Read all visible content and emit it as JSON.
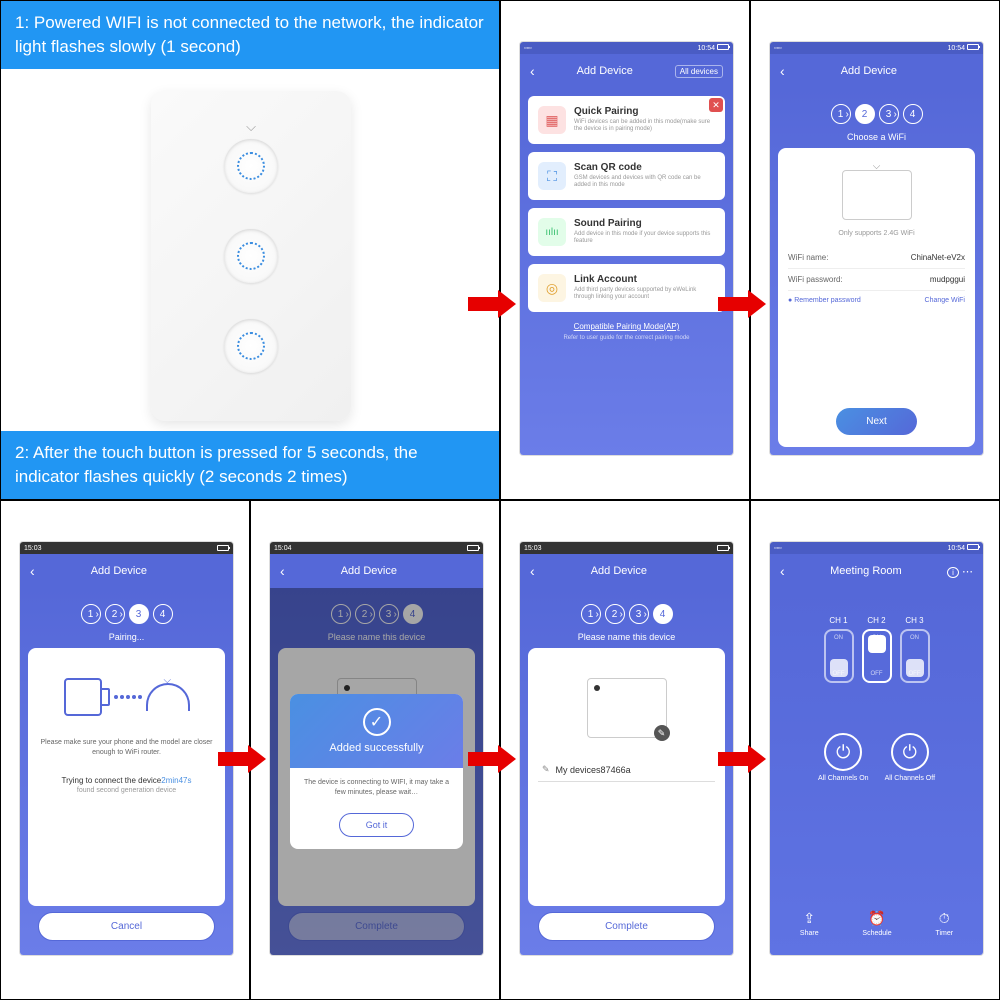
{
  "layout": {
    "instruction1": "1: Powered WIFI is not connected to the network, the indicator light flashes slowly (1 second)",
    "instruction2": "2: After the touch button is pressed for 5 seconds, the indicator flashes quickly (2 seconds 2 times)"
  },
  "common": {
    "addDeviceTitle": "Add Device",
    "back": "‹",
    "allDevices": "All devices",
    "steps": [
      "1",
      "2",
      "3",
      "4"
    ],
    "statusbarTime1": "10:54",
    "statusbarTime2": "15:03",
    "statusbarTime3": "15:04"
  },
  "screen1": {
    "cards": [
      {
        "title": "Quick Pairing",
        "desc": "WiFi devices can be added in this mode(make sure the device is in pairing mode)",
        "iconColor": "#fde2e2",
        "iconGlyph": "▦"
      },
      {
        "title": "Scan QR code",
        "desc": "GSM devices and devices with QR code can be added in this mode",
        "iconColor": "#e2eefd",
        "iconGlyph": "⛶"
      },
      {
        "title": "Sound Pairing",
        "desc": "Add device in this mode if your device supports this feature",
        "iconColor": "#e2fde9",
        "iconGlyph": "ıılıı"
      },
      {
        "title": "Link Account",
        "desc": "Add third party devices supported by eWeLink through linking your account",
        "iconColor": "#fdf5e2",
        "iconGlyph": "◎"
      }
    ],
    "compatLink": "Compatible Pairing Mode(AP)",
    "referText": "Refer to user guide for the correct pairing mode",
    "closeGlyph": "✕"
  },
  "screen2": {
    "subtitle": "Choose a WiFi",
    "supportsText": "Only supports 2.4G WiFi",
    "wifiNameLabel": "WiFi name:",
    "wifiNameValue": "ChinaNet-eV2x",
    "wifiPassLabel": "WiFi password:",
    "wifiPassValue": "mudpggui",
    "remember": "Remember password",
    "changeWifi": "Change WiFi",
    "nextBtn": "Next"
  },
  "screen3": {
    "subtitle": "Pairing...",
    "hint": "Please make sure your phone and the model are closer enough to WiFi router.",
    "connectingPrefix": "Trying to connect the device",
    "connectingTime": "2min47s",
    "found": "found second generation device",
    "cancelBtn": "Cancel"
  },
  "screen4": {
    "subtitle": "Please name this device",
    "modalTitle": "Added successfully",
    "modalDesc": "The device is connecting to WIFI, it may take a few minutes, please wait…",
    "gotIt": "Got it",
    "completeBtn": "Complete"
  },
  "screen5": {
    "subtitle": "Please name this device",
    "pencilGlyph": "✎",
    "deviceName": "My devices87466a",
    "completeBtn": "Complete"
  },
  "screen6": {
    "title": "Meeting Room",
    "infoGlyph": "i",
    "moreGlyph": "⋯",
    "channels": [
      {
        "label": "CH 1",
        "state": "off"
      },
      {
        "label": "CH 2",
        "state": "on"
      },
      {
        "label": "CH 3",
        "state": "off"
      }
    ],
    "onText": "ON",
    "offText": "OFF",
    "allOn": "All Channels On",
    "allOff": "All Channels Off",
    "actions": [
      {
        "icon": "⇪",
        "label": "Share"
      },
      {
        "icon": "⏰",
        "label": "Schedule"
      },
      {
        "icon": "⏱",
        "label": "Timer"
      }
    ]
  }
}
